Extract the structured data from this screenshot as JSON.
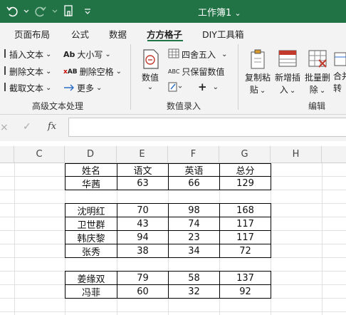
{
  "app": {
    "title": "工作簿1",
    "title_caret": "⌄",
    "accent": "#217346"
  },
  "tabs": [
    {
      "label": "页面布局"
    },
    {
      "label": "公式"
    },
    {
      "label": "数据"
    },
    {
      "label": "方方格子",
      "active": true
    },
    {
      "label": "DIY工具箱"
    }
  ],
  "ribbon": {
    "text_group": {
      "label": "高级文本处理",
      "items": [
        {
          "label": "插入文本",
          "caret": "⌄",
          "icon": "insert-text-icon"
        },
        {
          "label": "删除文本",
          "caret": "⌄",
          "icon": "delete-text-icon"
        },
        {
          "label": "截取文本",
          "caret": "⌄",
          "icon": "extract-text-icon"
        },
        {
          "label": "大小写",
          "caret": "⌄",
          "icon_text": "Ab"
        },
        {
          "label": "删除空格",
          "caret": "⌄",
          "icon_text": "AB"
        },
        {
          "label": "更多",
          "caret": "⌄",
          "icon": "arrow-right-icon"
        }
      ]
    },
    "number_group": {
      "label": "数值录入",
      "numeric": {
        "label": "数值",
        "caret": "⌄"
      },
      "round": {
        "label": "四舍五入",
        "caret": "⌄"
      },
      "keep_numbers": {
        "label": "只保留数值",
        "icon_text": "ABC"
      },
      "plus": "+"
    },
    "edit_group": {
      "label": "编辑",
      "copy_paste": {
        "label1": "复制粘",
        "label2": "贴",
        "caret": "⌄"
      },
      "insert": {
        "label1": "新增插",
        "label2": "入",
        "caret": "⌄"
      },
      "batch_delete": {
        "label1": "批量删",
        "label2": "除",
        "caret": "⌄"
      },
      "merge": {
        "label1": "合并",
        "label2": "转"
      }
    }
  },
  "formula_bar": {
    "cancel": "×",
    "confirm": "✓",
    "fx": "fx",
    "value": ""
  },
  "columns": [
    "C",
    "D",
    "E",
    "F",
    "G",
    "H"
  ],
  "table": {
    "headers": [
      "姓名",
      "语文",
      "英语",
      "总分"
    ],
    "block1": [
      [
        "华茜",
        "63",
        "66",
        "129"
      ]
    ],
    "block2": [
      [
        "沈明红",
        "70",
        "98",
        "168"
      ],
      [
        "卫世群",
        "43",
        "74",
        "117"
      ],
      [
        "韩庆黎",
        "94",
        "23",
        "117"
      ],
      [
        "张秀",
        "38",
        "34",
        "72"
      ]
    ],
    "block3": [
      [
        "姜缘双",
        "79",
        "58",
        "137"
      ],
      [
        "冯菲",
        "60",
        "32",
        "92"
      ]
    ]
  }
}
